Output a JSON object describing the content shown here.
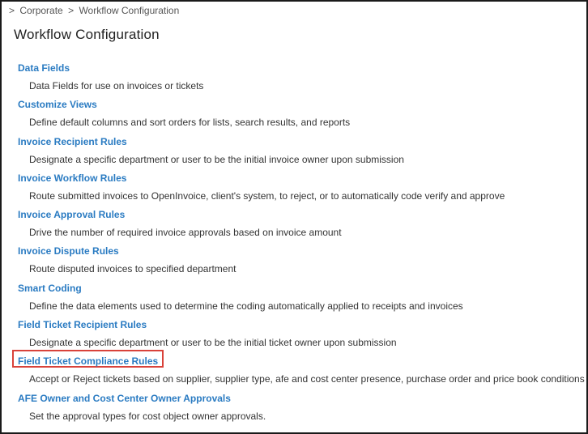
{
  "breadcrumb": {
    "prefix": ">",
    "corporate": "Corporate",
    "separator": ">",
    "current": "Workflow Configuration"
  },
  "page_title": "Workflow Configuration",
  "highlight_color": "#d9423a",
  "link_color": "#2a7bc2",
  "items": [
    {
      "label": "Data Fields",
      "description": "Data Fields for use on invoices or tickets"
    },
    {
      "label": "Customize Views",
      "description": "Define default columns and sort orders for lists, search results, and reports"
    },
    {
      "label": "Invoice Recipient Rules",
      "description": "Designate a specific department or user to be the initial invoice owner upon submission"
    },
    {
      "label": "Invoice Workflow Rules",
      "description": "Route submitted invoices to OpenInvoice, client's system, to reject, or to automatically code verify and approve"
    },
    {
      "label": "Invoice Approval Rules",
      "description": "Drive the number of required invoice approvals based on invoice amount"
    },
    {
      "label": "Invoice Dispute Rules",
      "description": "Route disputed invoices to specified department"
    },
    {
      "label": "Smart Coding",
      "description": "Define the data elements used to determine the coding automatically applied to receipts and invoices"
    },
    {
      "label": "Field Ticket Recipient Rules",
      "description": "Designate a specific department or user to be the initial ticket owner upon submission"
    },
    {
      "label": "Field Ticket Compliance Rules",
      "description": "Accept or Reject tickets based on supplier, supplier type, afe and cost center presence, purchase order and price book conditions",
      "highlighted": true
    },
    {
      "label": "AFE Owner and Cost Center Owner Approvals",
      "description": "Set the approval types for cost object owner approvals."
    }
  ]
}
